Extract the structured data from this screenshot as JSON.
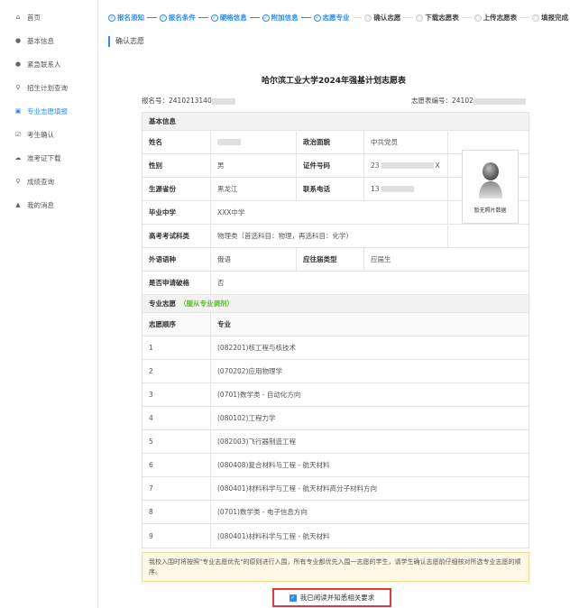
{
  "sidebar": {
    "items": [
      {
        "label": "首页",
        "icon": "home-icon",
        "glyph": "⌂"
      },
      {
        "label": "基本信息",
        "icon": "user-icon",
        "glyph": "●"
      },
      {
        "label": "紧急联系人",
        "icon": "contact-icon",
        "glyph": "●"
      },
      {
        "label": "招生计划查询",
        "icon": "search-icon",
        "glyph": "⚲"
      },
      {
        "label": "专业志愿填报",
        "icon": "form-icon",
        "glyph": "▣"
      },
      {
        "label": "考生确认",
        "icon": "check-square-icon",
        "glyph": "☑"
      },
      {
        "label": "准考证下载",
        "icon": "cloud-download-icon",
        "glyph": "☁"
      },
      {
        "label": "成绩查询",
        "icon": "search-icon",
        "glyph": "⚲"
      },
      {
        "label": "我的消息",
        "icon": "bell-icon",
        "glyph": "▲"
      }
    ],
    "active_index": 4
  },
  "steps": [
    {
      "label": "报名须知",
      "status": "done"
    },
    {
      "label": "报名条件",
      "status": "done"
    },
    {
      "label": "硬格信息",
      "status": "done"
    },
    {
      "label": "附加信息",
      "status": "done"
    },
    {
      "label": "志愿专业",
      "status": "done"
    },
    {
      "label": "确认志愿",
      "status": "todo"
    },
    {
      "label": "下载志愿表",
      "status": "todo"
    },
    {
      "label": "上传志愿表",
      "status": "todo"
    },
    {
      "label": "填报完成",
      "status": "todo"
    }
  ],
  "page_title": "确认志愿",
  "form": {
    "title": "哈尔滨工业大学2024年强基计划志愿表",
    "reg_label": "报名号：",
    "reg_value": "2410213140",
    "app_label": "志愿表编号：",
    "app_value": "24102",
    "basic_section": "基本信息",
    "name_label": "姓名",
    "political_label": "政治面貌",
    "political_value": "中共党员",
    "gender_label": "性别",
    "gender_value": "男",
    "id_label": "证件号码",
    "id_value_prefix": "23",
    "id_value_suffix": "X",
    "province_label": "生源省份",
    "province_value": "黑龙江",
    "phone_label": "联系电话",
    "phone_value": "13",
    "school_label": "毕业中学",
    "school_value": "XXX中学",
    "exam_label": "高考考试科类",
    "exam_value": "物理类（首选科目：物理，再选科目：化学）",
    "lang_label": "外语语种",
    "lang_value": "俄语",
    "grad_type_label": "应往届类型",
    "grad_type_value": "应届生",
    "apply_label": "是否申请破格",
    "apply_value": "否",
    "photo_caption": "暂无照片数据",
    "major_section": "专业志愿",
    "major_note": "（服从专业调剂）",
    "col_order": "志愿顺序",
    "col_major": "专业",
    "majors": [
      {
        "order": "1",
        "name": "(082201)核工程与核技术"
      },
      {
        "order": "2",
        "name": "(070202)应用物理学"
      },
      {
        "order": "3",
        "name": "(0701)数学类 - 自动化方向"
      },
      {
        "order": "4",
        "name": "(080102)工程力学"
      },
      {
        "order": "5",
        "name": "(082003)飞行器制造工程"
      },
      {
        "order": "6",
        "name": "(080408)复合材料与工程 - 航天材料"
      },
      {
        "order": "7",
        "name": "(080401)材料科学与工程 - 航天材料高分子材料方向"
      },
      {
        "order": "8",
        "name": "(0701)数学类 - 电子信息方向"
      },
      {
        "order": "9",
        "name": "(080401)材料科学与工程 - 航天材料"
      }
    ]
  },
  "notice": "我校入围时将按照\"专业志愿优先\"的原则进行入围，所有专业都优先入围一志愿的学生，请学生确认志愿前仔细核对所选专业志愿的顺序。",
  "agree_label": "我已阅读并知悉相关要求",
  "colors": {
    "accent": "#2d8cf0",
    "green": "#52c41a",
    "red": "#e53935"
  }
}
